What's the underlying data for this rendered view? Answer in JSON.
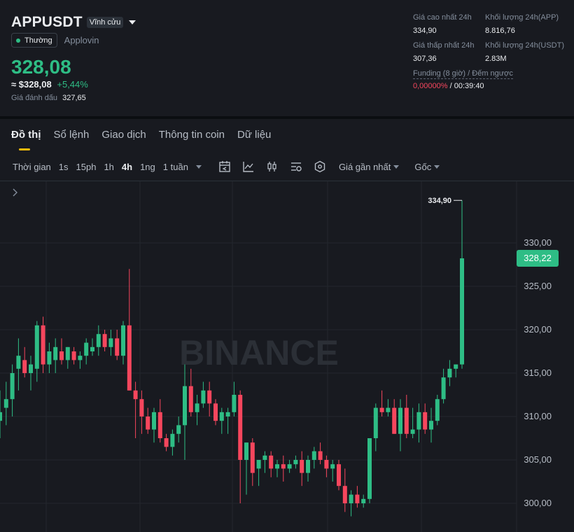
{
  "header": {
    "symbol": "APPUSDT",
    "contract_type": "Vĩnh cửu",
    "status_badge": "Thường",
    "company": "Applovin",
    "last_price": "328,08",
    "usd_price": "≈ $328,08",
    "change_pct": "+5,44%",
    "mark_label": "Giá đánh dấu",
    "mark_value": "327,65"
  },
  "stats": {
    "high_label": "Giá cao nhất 24h",
    "high_value": "334,90",
    "low_label": "Giá thấp nhất 24h",
    "low_value": "307,36",
    "vol_base_label": "Khối lượng 24h(APP)",
    "vol_base_value": "8.816,76",
    "vol_quote_label": "Khối lượng 24h(USDT)",
    "vol_quote_value": "2.83M",
    "funding_label": "Funding (8 giờ) / Đếm ngược",
    "funding_rate": "0,00000%",
    "funding_sep": "/",
    "countdown": "00:39:40"
  },
  "tabs": [
    "Đồ thị",
    "Sổ lệnh",
    "Giao dịch",
    "Thông tin coin",
    "Dữ liệu"
  ],
  "toolbar": {
    "time_label": "Thời gian",
    "intervals": [
      "1s",
      "15ph",
      "1h",
      "4h",
      "1ng",
      "1 tuần"
    ],
    "active_interval": "4h",
    "price_type": "Giá gần nhất",
    "mode": "Gốc"
  },
  "icons": {
    "expand": "chevron-right-icon",
    "toolbar": [
      "calendar-icon",
      "indicator-icon",
      "candle-type-icon",
      "settings-chart-icon",
      "shield-icon"
    ]
  },
  "colors": {
    "up": "#2ebd85",
    "down": "#f6465d",
    "accent": "#f0b90b"
  },
  "watermark": "BINANCE",
  "chart_data": {
    "type": "candlestick",
    "y_ticks": [
      "330,00",
      "325,00",
      "320,00",
      "315,00",
      "310,00",
      "305,00",
      "300,00"
    ],
    "y_tick_values": [
      330,
      325,
      320,
      315,
      310,
      305,
      300
    ],
    "current_price": "328,22",
    "high_label": "334,90",
    "high_value": 334.9,
    "ohlc": [
      [
        309.5,
        313,
        307.5,
        310.5
      ],
      [
        311,
        314,
        309,
        312
      ],
      [
        312,
        316,
        310,
        315
      ],
      [
        315.5,
        319,
        313,
        317
      ],
      [
        316.5,
        318,
        314.5,
        315
      ],
      [
        315,
        317,
        313,
        316
      ],
      [
        315.5,
        321,
        314,
        320.5
      ],
      [
        320.5,
        321.5,
        315,
        316
      ],
      [
        316,
        318.5,
        315,
        317.5
      ],
      [
        316.5,
        319,
        315,
        318
      ],
      [
        317.5,
        319,
        316,
        316.5
      ],
      [
        316.5,
        318,
        315.5,
        318
      ],
      [
        317.5,
        318,
        316,
        316.5
      ],
      [
        316.5,
        317.5,
        315.5,
        317
      ],
      [
        317,
        319,
        316,
        318.5
      ],
      [
        317.5,
        319,
        317,
        318
      ],
      [
        318,
        320.5,
        317,
        319.5
      ],
      [
        319.5,
        320,
        317.5,
        318
      ],
      [
        318,
        320,
        317,
        319
      ],
      [
        319,
        320,
        316.5,
        317
      ],
      [
        317,
        321,
        316,
        320.5
      ],
      [
        320.5,
        327,
        313,
        313
      ],
      [
        313,
        314,
        307.5,
        312
      ],
      [
        312,
        313,
        308,
        310
      ],
      [
        310,
        311,
        308,
        308.5
      ],
      [
        308.5,
        311,
        307,
        310.5
      ],
      [
        310.5,
        312,
        307,
        307.5
      ],
      [
        307.5,
        308,
        306,
        306.5
      ],
      [
        306.5,
        308.5,
        305.5,
        308
      ],
      [
        308,
        310,
        307,
        309
      ],
      [
        309,
        316,
        305,
        313.5
      ],
      [
        313.5,
        315.5,
        310,
        310.5
      ],
      [
        310.5,
        312.5,
        309,
        311.5
      ],
      [
        311.5,
        314,
        311,
        313
      ],
      [
        313,
        314,
        310,
        311.5
      ],
      [
        311.5,
        312,
        309,
        309.5
      ],
      [
        309.5,
        311,
        308,
        310.5
      ],
      [
        310,
        311,
        308,
        310.5
      ],
      [
        310.5,
        314,
        310,
        312.5
      ],
      [
        312.5,
        313,
        300,
        305
      ],
      [
        305,
        307,
        301,
        307
      ],
      [
        307,
        307.5,
        302,
        303.5
      ],
      [
        304,
        305,
        302,
        305
      ],
      [
        305,
        306,
        303.5,
        305.5
      ],
      [
        305.5,
        306,
        303,
        304
      ],
      [
        304,
        305,
        303,
        304.5
      ],
      [
        304.5,
        305.5,
        302.5,
        304
      ],
      [
        304,
        305,
        303.5,
        304.5
      ],
      [
        304.5,
        305.5,
        304,
        305
      ],
      [
        305,
        306,
        302,
        303.5
      ],
      [
        303.5,
        305.5,
        302.5,
        305
      ],
      [
        305,
        306.5,
        304,
        306
      ],
      [
        306,
        307,
        304.5,
        305
      ],
      [
        305,
        305.5,
        303,
        304
      ],
      [
        304,
        305,
        302.5,
        304.5
      ],
      [
        304.5,
        305,
        301.5,
        302
      ],
      [
        302,
        304,
        299,
        300
      ],
      [
        300,
        301.5,
        298.5,
        301
      ],
      [
        301,
        302,
        299.5,
        300
      ],
      [
        300,
        301,
        299.5,
        300.5
      ],
      [
        300.5,
        307,
        300,
        307.5
      ],
      [
        307.5,
        311.5,
        306,
        311
      ],
      [
        311,
        313,
        310,
        310.5
      ],
      [
        310.5,
        312,
        310,
        311
      ],
      [
        311,
        312,
        308,
        308
      ],
      [
        308,
        312,
        306,
        311
      ],
      [
        311,
        312.5,
        307.5,
        308
      ],
      [
        308,
        311,
        307.5,
        308.5
      ],
      [
        308.5,
        311.5,
        307,
        310.5
      ],
      [
        310.5,
        311.5,
        308,
        308.5
      ],
      [
        308.5,
        311,
        307,
        309.5
      ],
      [
        309.5,
        312.5,
        309,
        312
      ],
      [
        312,
        315.5,
        311.5,
        314.5
      ],
      [
        314.5,
        316.5,
        313.5,
        315.5
      ],
      [
        315.5,
        316,
        314.5,
        316
      ],
      [
        316,
        334.9,
        315.5,
        328.22
      ]
    ]
  }
}
